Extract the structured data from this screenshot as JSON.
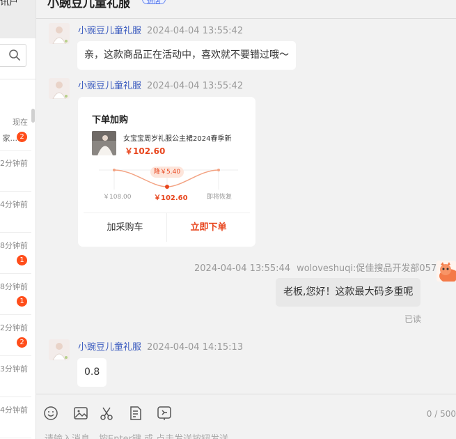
{
  "sidebar": {
    "top_text": "讯户",
    "conversations": [
      {
        "time": "现在",
        "preview": "家...",
        "badge": "2"
      },
      {
        "time": "2分钟前",
        "preview": "",
        "badge": ""
      },
      {
        "time": "4分钟前",
        "preview": "",
        "badge": ""
      },
      {
        "time": "8分钟前",
        "preview": "",
        "badge": "1"
      },
      {
        "time": "8分钟前",
        "preview": "",
        "badge": "1"
      },
      {
        "time": "2分钟前",
        "preview": "",
        "badge": "2"
      },
      {
        "time": "3分钟前",
        "preview": "",
        "badge": ""
      },
      {
        "time": "4分钟前",
        "preview": "",
        "badge": ""
      }
    ]
  },
  "header": {
    "title": "小豌豆儿童礼服",
    "tag": "进店"
  },
  "messages": [
    {
      "sender": "小豌豆儿童礼服",
      "time": "2024-04-04 13:55:42",
      "text": "亲，这款商品正在活动中，喜欢就不要错过哦～"
    },
    {
      "sender": "小豌豆儿童礼服",
      "time": "2024-04-04 13:55:42"
    },
    {
      "sender": "woloveshuqi:促佳搜品开发部057",
      "time": "2024-04-04 13:55:44",
      "text": "老板,您好！这款最大码多重呢",
      "status": "已读"
    },
    {
      "sender": "小豌豆儿童礼服",
      "time": "2024-04-04 14:15:13",
      "text": "0.8"
    }
  ],
  "card": {
    "title": "下单加购",
    "product_name": "女宝宝周岁礼服公主裙2024春季新",
    "price": "￥102.60",
    "drop_badge": "降￥5.40",
    "trend": {
      "before": "￥108.00",
      "now": "￥102.60",
      "after": "即将恢复"
    },
    "btn_cart": "加采购车",
    "btn_order": "立即下单"
  },
  "input": {
    "char_count": "0 / 500",
    "placeholder": "请输入消息，按Enter键 或 点击发送按钮发送"
  },
  "colors": {
    "accent": "#e8461e",
    "badge": "#ff4d1a",
    "link": "#3b5bbf"
  }
}
